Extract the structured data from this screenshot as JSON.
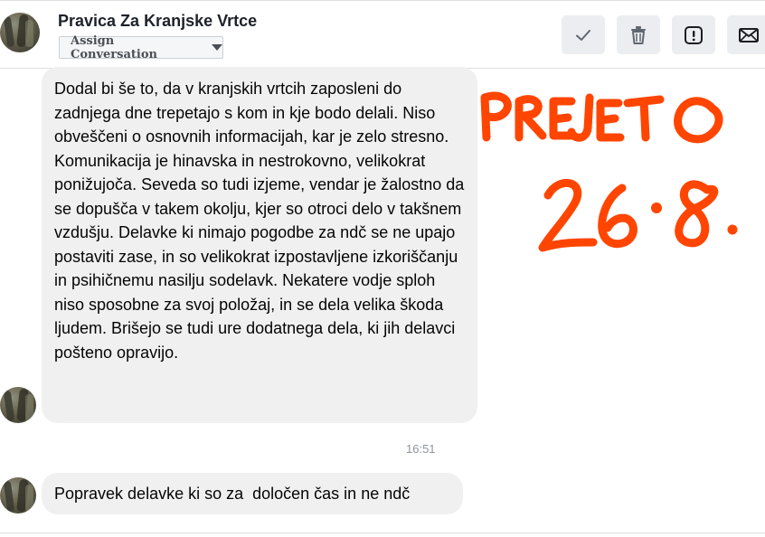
{
  "header": {
    "title": "Pravica Za Kranjske Vrtce",
    "assign_label": "Assign Conversation",
    "actions": [
      "checkmark-icon",
      "trash-icon",
      "alert-icon",
      "envelope-icon"
    ]
  },
  "messages": [
    {
      "text": "Dodal bi še to, da v kranjskih vrtcih zaposleni do zadnjega dne trepetajo s kom in kje bodo delali. Niso obveščeni o osnovnih informacijah, kar je zelo stresno. Komunikacija je hinavska in nestrokovno, velikokrat ponižujoča. Seveda so tudi izjeme, vendar je žalostno da se dopušča v takem okolju, kjer so otroci delo v takšnem vzdušju. Delavke ki nimajo pogodbe za ndč se ne upajo postaviti zase, in so velikokrat izpostavljene izkoriščanju in psihičnemu nasilju sodelavk. Nekatere vodje sploh niso sposobne za svoj položaj, in se dela velika škoda ljudem. Brišejo se tudi ure dodatnega dela, ki jih delavci pošteno opravijo."
    },
    {
      "text": "Popravek delavke ki so za  določen čas in ne ndč"
    }
  ],
  "timestamp": "16:51",
  "annotation": {
    "line1": "PREJETO",
    "line2": "26.8.",
    "color": "#ff4500"
  },
  "colors": {
    "bubble": "#f0f0f0",
    "button_bg": "#ebedf0",
    "muted_text": "#90949c"
  }
}
